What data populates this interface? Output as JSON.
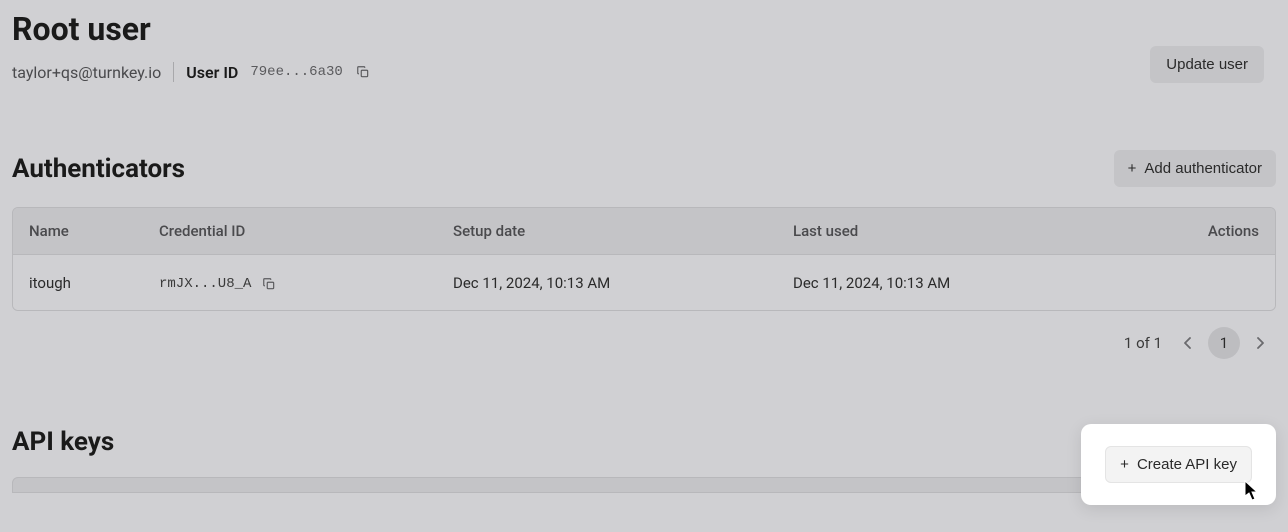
{
  "header": {
    "title": "Root user",
    "email": "taylor+qs@turnkey.io",
    "user_id_label": "User ID",
    "user_id_value": "79ee...6a30",
    "update_button": "Update user"
  },
  "authenticators": {
    "title": "Authenticators",
    "add_button": "Add authenticator",
    "columns": {
      "name": "Name",
      "credential_id": "Credential ID",
      "setup_date": "Setup date",
      "last_used": "Last used",
      "actions": "Actions"
    },
    "rows": [
      {
        "name": "itough",
        "credential_id": "rmJX...U8_A",
        "setup_date": "Dec 11, 2024, 10:13 AM",
        "last_used": "Dec 11, 2024, 10:13 AM"
      }
    ],
    "pagination": {
      "summary": "1 of 1",
      "current_page": "1"
    }
  },
  "api_keys": {
    "title": "API keys",
    "create_button": "Create API key"
  }
}
